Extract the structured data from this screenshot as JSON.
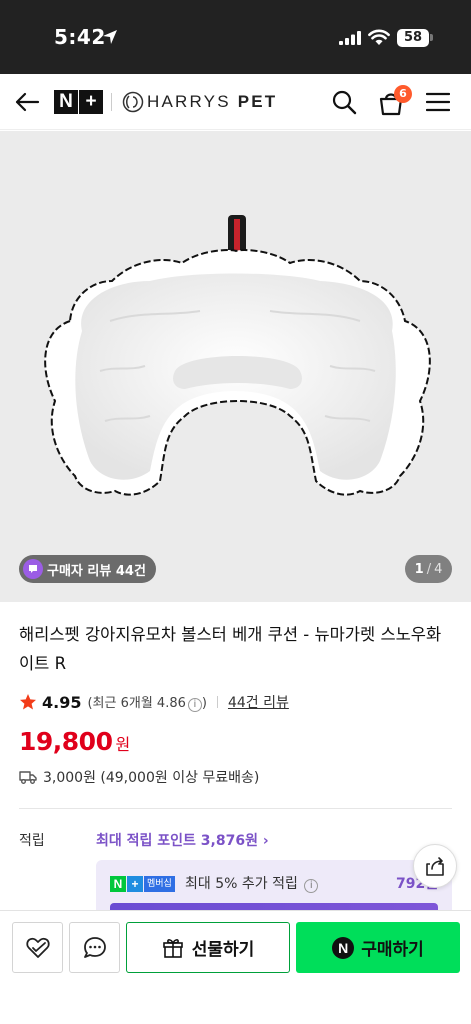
{
  "status_bar": {
    "time": "5:42",
    "battery": "58"
  },
  "header": {
    "logo_n": "N",
    "logo_plus": "+",
    "brand_name_light": "HARRYS",
    "brand_name_bold": "PET",
    "cart_count": "6"
  },
  "gallery": {
    "review_chip": "구매자 리뷰 44건",
    "current": "1",
    "separator": "/",
    "total": "4"
  },
  "product": {
    "title": "해리스펫 강아지유모차 볼스터 베개 쿠션 - 뉴마가렛 스노우화이트 R",
    "rating": "4.95",
    "recent_rating_text": "(최근 6개월 4.86",
    "recent_rating_close": ")",
    "info_glyph": "i",
    "review_link": "44건 리뷰",
    "price": "19,800",
    "price_unit": "원",
    "shipping": "3,000원 (49,000원 이상 무료배송)"
  },
  "points": {
    "label": "적립",
    "max_points_link": "최대 적립 포인트 3,876원 ›",
    "membership_n": "N",
    "membership_plus": "+",
    "membership_badge_text": "멤버십",
    "membership_text": "최대 5% 추가 적립",
    "membership_value": "792원"
  },
  "bottom_bar": {
    "gift_label": "선물하기",
    "buy_label": "구매하기",
    "npay_glyph": "N"
  },
  "colors": {
    "price_red": "#e0001b",
    "naver_green": "#00de5a",
    "points_purple": "#7b52c7",
    "cart_badge": "#ff5a2c"
  }
}
